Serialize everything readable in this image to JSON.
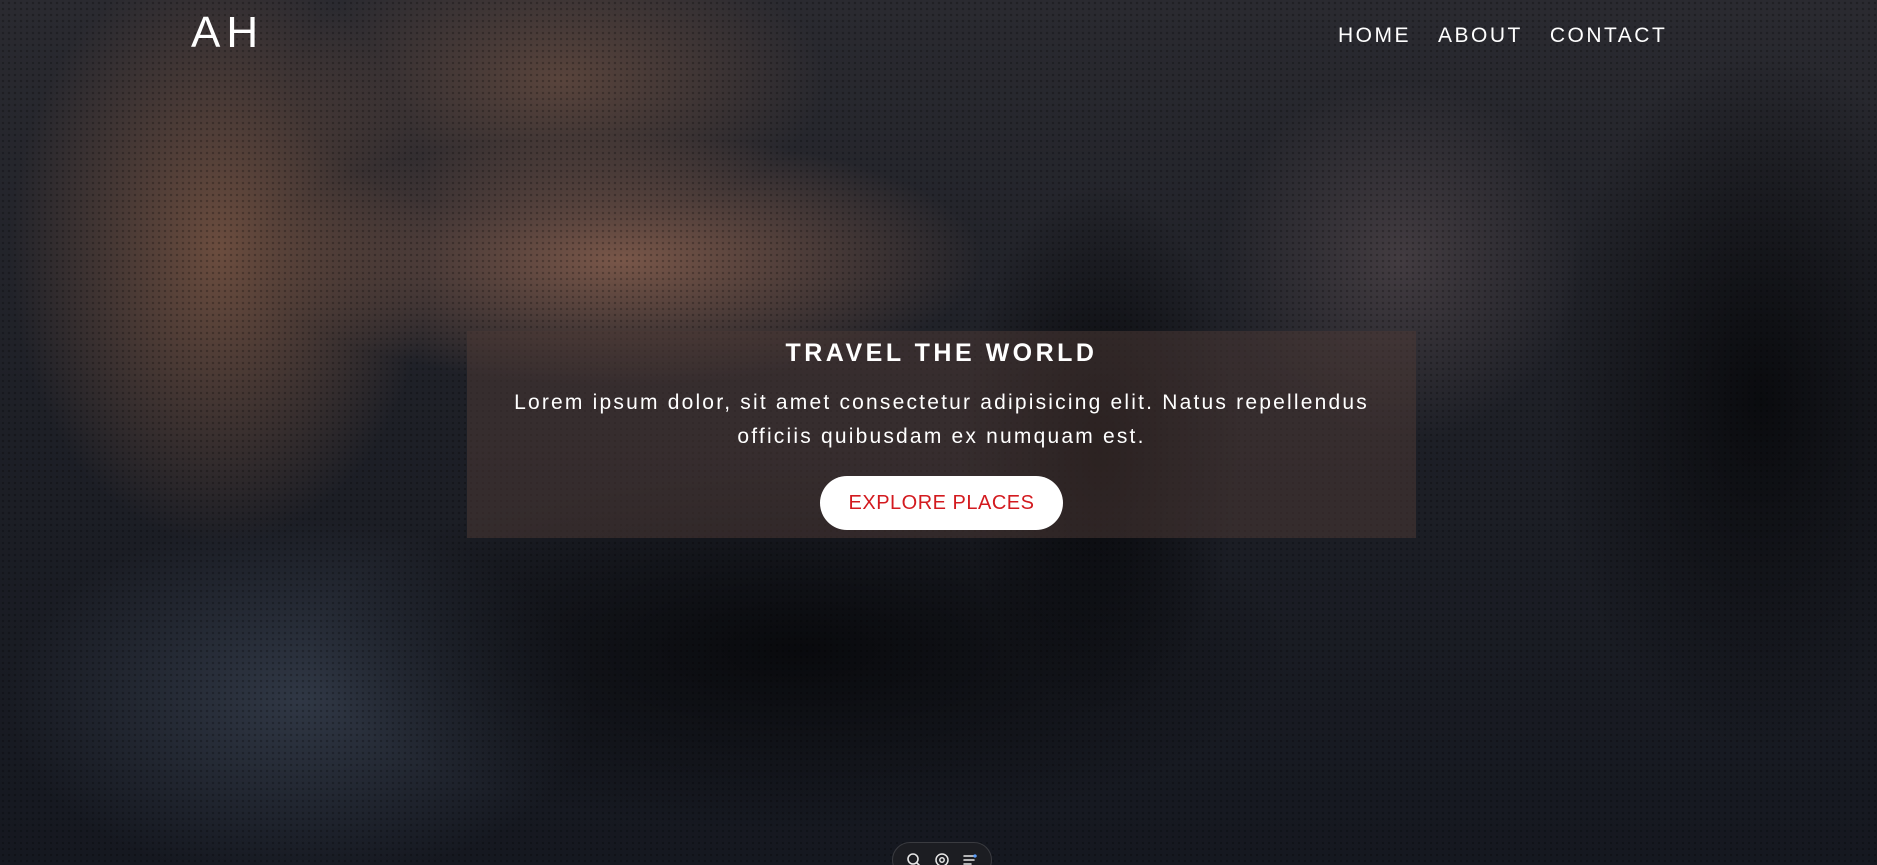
{
  "header": {
    "logo": "AH",
    "nav": [
      {
        "label": "HOME"
      },
      {
        "label": "ABOUT"
      },
      {
        "label": "CONTACT"
      }
    ]
  },
  "hero": {
    "title": "TRAVEL THE WORLD",
    "description": "Lorem ipsum dolor, sit amet consectetur adipisicing elit. Natus repellendus officiis quibusdam ex numquam est.",
    "cta_label": "EXPLORE PLACES"
  },
  "floating_toolbar": {
    "icons": [
      "search-icon",
      "settings-icon",
      "filter-icon"
    ]
  },
  "colors": {
    "cta_text": "#d31a1f",
    "cta_bg": "#ffffff",
    "text": "#ffffff",
    "overlay": "#4a3834"
  }
}
